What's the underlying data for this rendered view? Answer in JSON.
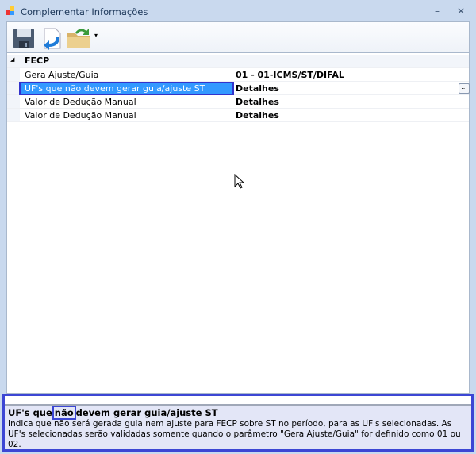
{
  "window": {
    "title": "Complementar Informações",
    "minimize": "–",
    "close": "✕"
  },
  "toolbar": {
    "items": [
      "save-icon",
      "undo-icon",
      "open-folder-icon"
    ],
    "dropdown": "▾"
  },
  "grid": {
    "category": {
      "toggle": "◢",
      "label": "FECP"
    },
    "rows": [
      {
        "name": "Gera Ajuste/Guia",
        "value": "01 - 01-ICMS/ST/DIFAL"
      },
      {
        "name": "UF's que não devem gerar guia/ajuste ST",
        "value": "Detalhes",
        "button": "..."
      },
      {
        "name": "Valor de Dedução Manual",
        "value": "Detalhes"
      },
      {
        "name": "Valor de Dedução Manual",
        "value": "Detalhes"
      }
    ]
  },
  "help": {
    "title_pre": "UF's que",
    "title_hl": "não",
    "title_post": "devem gerar guia/ajuste ST",
    "description": "Indica que não será gerada guia nem ajuste para FECP sobre ST no período, para as UF's selecionadas. As UF's selecionadas serão validadas somente quando o parâmetro \"Gera Ajuste/Guia\" for definido como 01 ou 02."
  }
}
